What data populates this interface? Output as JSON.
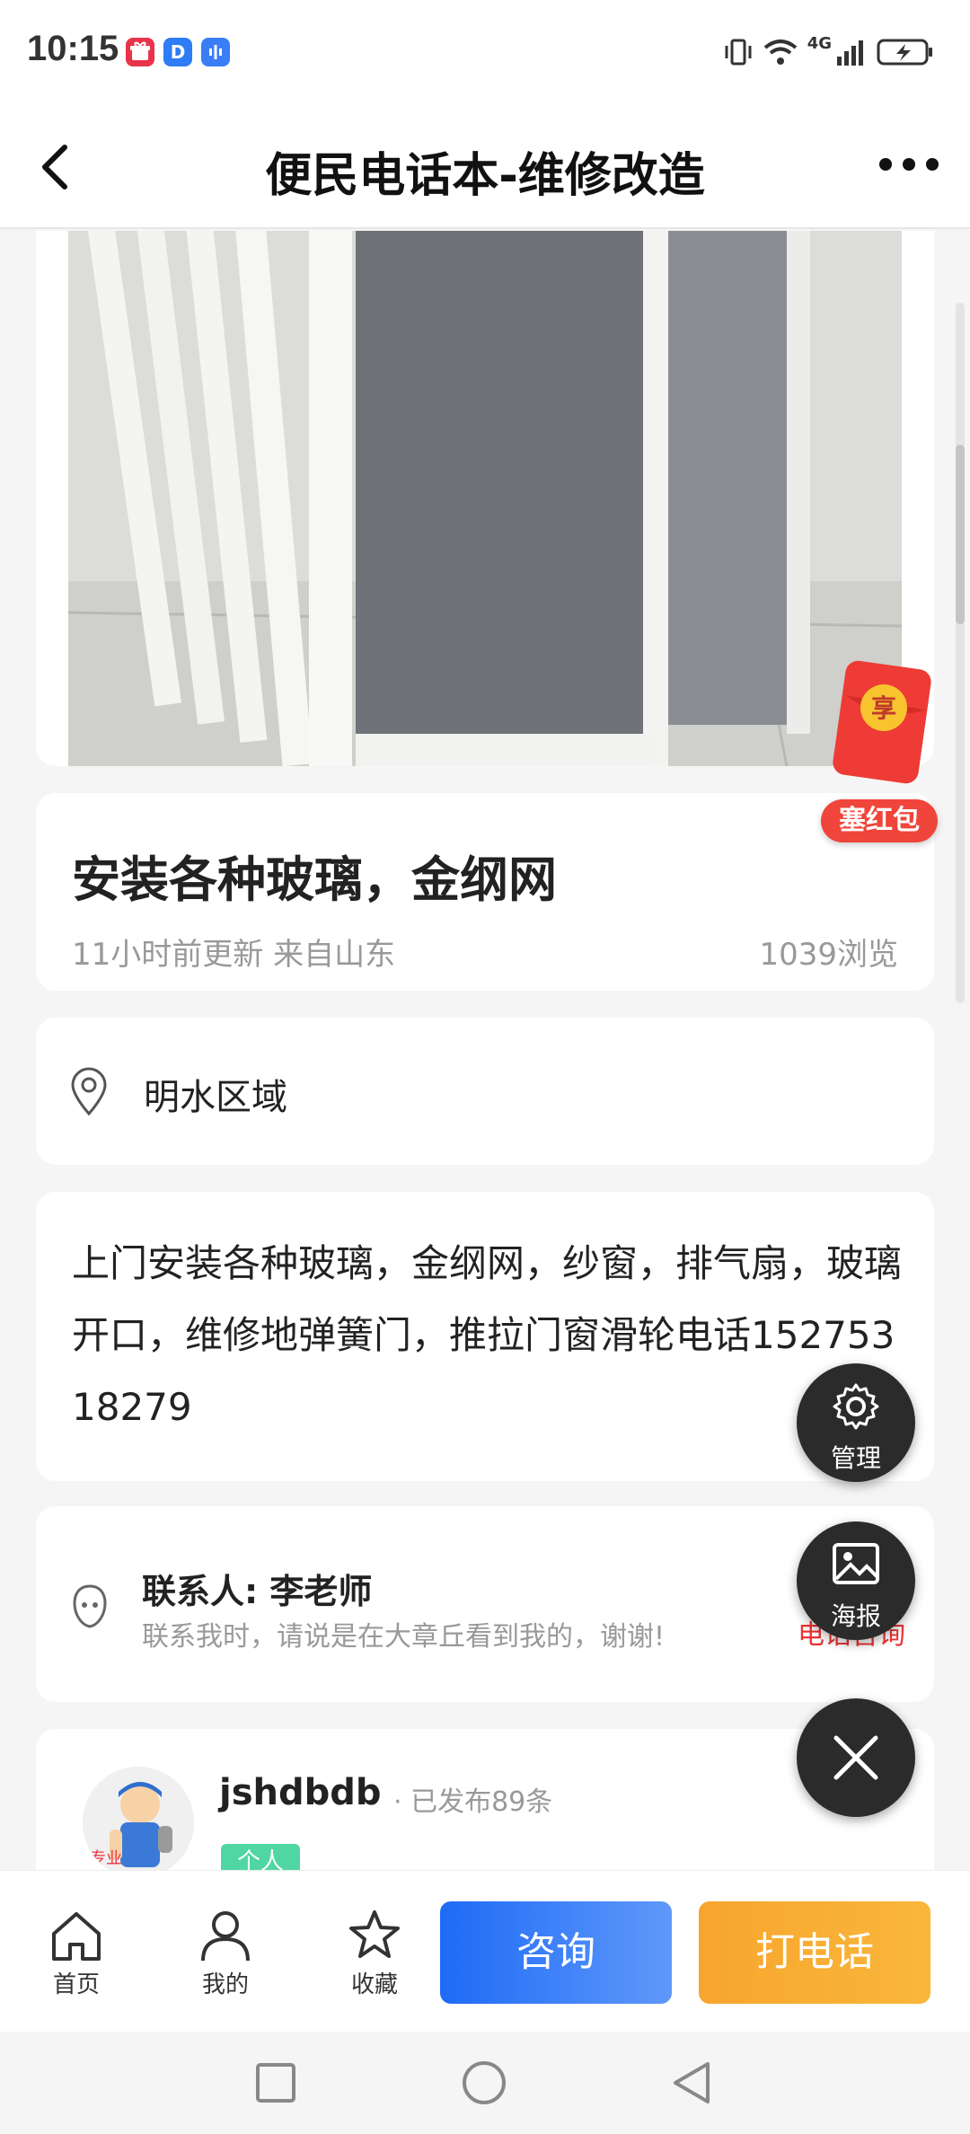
{
  "status_bar": {
    "time": "10:15",
    "apps": [
      {
        "icon": "gift-app-icon",
        "color": "#e8344a"
      },
      {
        "icon": "d-app-icon",
        "label": "D",
        "color": "#2f7cf6"
      },
      {
        "icon": "voice-app-icon",
        "color": "#3a7ef5"
      }
    ],
    "network": "4G"
  },
  "navbar": {
    "title": "便民电话本-维修改造",
    "back_icon": "chevron-left-icon",
    "more_icon": "more-dots-icon"
  },
  "post": {
    "title": "安装各种玻璃，金纲网",
    "meta": "11小时前更新 来自山东",
    "views": "1039浏览",
    "location": "明水区域",
    "description": "上门安装各种玻璃，金纲网，纱窗，排气扇，玻璃开口，维修地弹簧门，推拉门窗滑轮电话15275318279"
  },
  "contact": {
    "name": "联系人: 李老师",
    "tip": "联系我时，请说是在大章丘看到我的，谢谢!",
    "call_text": "电话咨询"
  },
  "publisher": {
    "name": "jshdbdb",
    "count": "· 已发布89条",
    "badge": "个人",
    "avatar_text": "专业"
  },
  "floating": {
    "red_packet_char": "享",
    "red_packet_label": "塞红包",
    "manage_label": "管理",
    "poster_label": "海报"
  },
  "bottom_bar": {
    "tabs": [
      {
        "label": "首页",
        "icon": "home-icon"
      },
      {
        "label": "我的",
        "icon": "user-icon"
      },
      {
        "label": "收藏",
        "icon": "star-icon"
      }
    ],
    "consult_label": "咨询",
    "call_label": "打电话"
  },
  "colors": {
    "consult": "#1f6bf7",
    "call": "#f7a52e",
    "badge": "#4fd6a3",
    "red_packet": "#f0453a"
  }
}
